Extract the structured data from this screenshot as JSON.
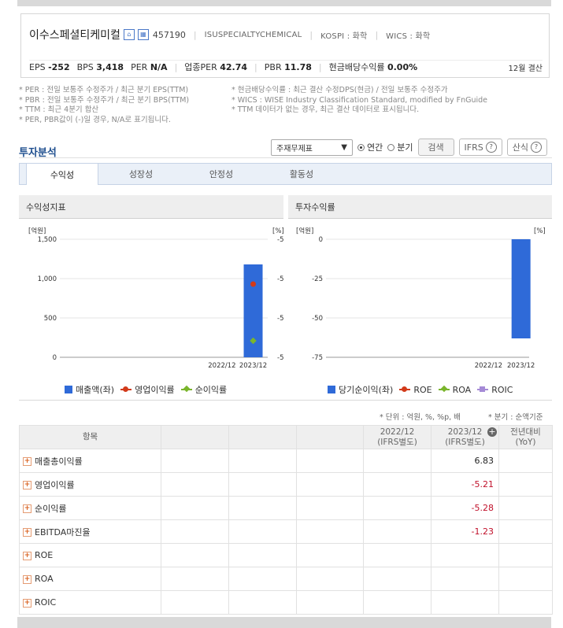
{
  "company": {
    "name": "이수스페셜티케미컬",
    "icon1": "home-icon",
    "icon2": "building-icon",
    "code": "457190",
    "english_name": "ISUSPECIALTYCHEMICAL",
    "market": "KOSPI : 화학",
    "wics": "WICS : 화학"
  },
  "metrics": {
    "eps_label": "EPS",
    "eps_value": "-252",
    "bps_label": "BPS",
    "bps_value": "3,418",
    "per_label": "PER",
    "per_value": "N/A",
    "sector_per_label": "업종PER",
    "sector_per_value": "42.74",
    "pbr_label": "PBR",
    "pbr_value": "11.78",
    "div_label": "현금배당수익률",
    "div_value": "0.00%",
    "settlement": "12월 결산"
  },
  "notes": {
    "left": [
      "* PER : 전일 보통주 수정주가 / 최근 분기 EPS(TTM)",
      "* PBR : 전일 보통주 수정주가 / 최근 분기 BPS(TTM)",
      "* TTM : 최근 4분기 합산",
      "* PER, PBR값이 (-)일 경우, N/A로 표기됩니다."
    ],
    "right": [
      "* 현금배당수익률 : 최근 결산 수정DPS(현금) / 전일 보통주 수정주가",
      "* WICS : WISE Industry Classification Standard, modified by FnGuide",
      "* TTM 데이터가 없는 경우, 최근 결산 데이터로 표시됩니다."
    ]
  },
  "section": {
    "title": "투자분석",
    "select_value": "주재무제표",
    "radio_annual": "연간",
    "radio_quarter": "분기",
    "search_btn": "검색",
    "ifrs_btn": "IFRS",
    "formula_btn": "산식"
  },
  "tabs": [
    "수익성",
    "성장성",
    "안정성",
    "활동성"
  ],
  "chart_left": {
    "panel_title": "수익성지표",
    "unit_left": "[억원]",
    "unit_right": "[%]"
  },
  "chart_right": {
    "panel_title": "투자수익률",
    "unit_left": "[억원]",
    "unit_right": "[%]"
  },
  "chart_data": [
    {
      "type": "bar",
      "categories": [
        "2022/12",
        "2023/12"
      ],
      "left_axis_ticks": [
        "1,500",
        "1,000",
        "500",
        "0"
      ],
      "right_axis_ticks": [
        "-5",
        "-5",
        "-5",
        "-5"
      ],
      "ylim": [
        0,
        1500
      ],
      "series": [
        {
          "name": "매출액(좌)",
          "kind": "bar",
          "values": [
            null,
            1180
          ],
          "color": "#2f6ad8"
        },
        {
          "name": "영업이익률",
          "kind": "line",
          "values": [
            null,
            -5.21
          ],
          "color": "#d23a1a"
        },
        {
          "name": "순이익률",
          "kind": "line",
          "values": [
            null,
            -5.28
          ],
          "color": "#7ab52c"
        }
      ]
    },
    {
      "type": "bar",
      "categories": [
        "2022/12",
        "2023/12"
      ],
      "left_axis_ticks": [
        "0",
        "-25",
        "-50",
        "-75"
      ],
      "ylim": [
        -75,
        0
      ],
      "series": [
        {
          "name": "당기순이익(좌)",
          "kind": "bar",
          "values": [
            null,
            -63
          ],
          "color": "#2f6ad8"
        },
        {
          "name": "ROE",
          "kind": "line",
          "values": [],
          "color": "#d23a1a"
        },
        {
          "name": "ROA",
          "kind": "line",
          "values": [],
          "color": "#7ab52c"
        },
        {
          "name": "ROIC",
          "kind": "line",
          "values": [],
          "color": "#a58ad6"
        }
      ]
    }
  ],
  "table": {
    "unit_note": "* 단위 : 억원, %, %p, 배",
    "quarter_note": "* 분기 : 순액기준",
    "header_item": "항목",
    "col_2022": "2022/12",
    "col_2023": "2023/12",
    "col_sub": "(IFRS별도)",
    "col_yoy": "전년대비",
    "col_yoy_sub": "(YoY)",
    "rows": [
      {
        "label": "매출총이익률",
        "v2023": "6.83"
      },
      {
        "label": "영업이익률",
        "v2023": "-5.21"
      },
      {
        "label": "순이익률",
        "v2023": "-5.28"
      },
      {
        "label": "EBITDA마진율",
        "v2023": "-1.23"
      },
      {
        "label": "ROE",
        "v2023": ""
      },
      {
        "label": "ROA",
        "v2023": ""
      },
      {
        "label": "ROIC",
        "v2023": ""
      }
    ]
  }
}
